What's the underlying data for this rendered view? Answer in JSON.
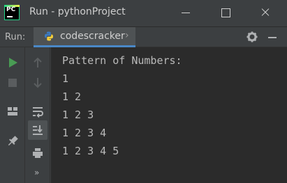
{
  "window": {
    "title": "Run - pythonProject",
    "app_icon_text": "PC"
  },
  "run_bar": {
    "label": "Run:",
    "tab_label": "codescracker",
    "tab_chevron": "›"
  },
  "icons": {
    "run": "play-icon",
    "stop": "stop-icon",
    "up": "arrow-up-icon",
    "down": "arrow-down-icon",
    "layout": "layout-icon",
    "soft_wrap": "soft-wrap-icon",
    "scroll_end": "scroll-to-end-icon",
    "pin": "pin-icon",
    "print": "print-icon",
    "more": "more-icon",
    "settings": "gear-icon",
    "hide": "minimize-panel-icon"
  },
  "colors": {
    "console_bg": "#2b2b2b",
    "panel_bg": "#3c3f41",
    "run_green": "#499c54",
    "accent_blue": "#4a88c7"
  },
  "console": {
    "lines": [
      "Pattern of Numbers:",
      "1",
      "1 2",
      "1 2 3",
      "1 2 3 4",
      "1 2 3 4 5"
    ]
  },
  "more_label": "»"
}
